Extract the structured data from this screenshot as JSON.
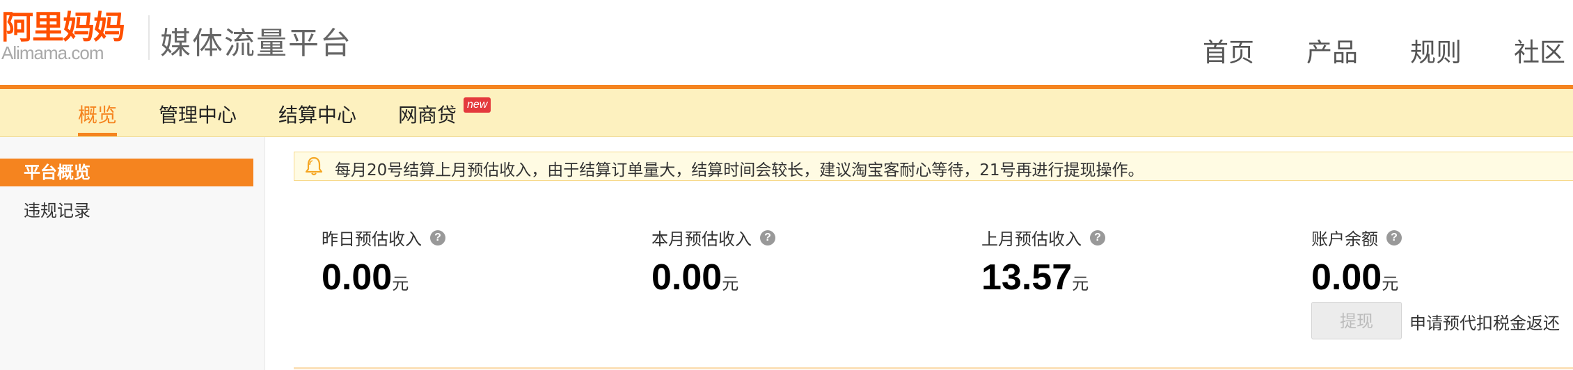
{
  "brand": {
    "logo_cn": "阿里妈妈",
    "logo_en": "Alimama.com",
    "platform_title": "媒体流量平台"
  },
  "top_nav": [
    {
      "label": "首页"
    },
    {
      "label": "产品"
    },
    {
      "label": "规则"
    },
    {
      "label": "社区"
    }
  ],
  "sub_nav": {
    "items": [
      {
        "label": "概览",
        "active": true
      },
      {
        "label": "管理中心"
      },
      {
        "label": "结算中心"
      },
      {
        "label": "网商贷"
      }
    ],
    "new_badge": "new"
  },
  "sidebar": {
    "items": [
      {
        "label": "平台概览",
        "active": true
      },
      {
        "label": "违规记录"
      }
    ]
  },
  "notice": {
    "icon": "bell-icon",
    "text": "每月20号结算上月预估收入，由于结算订单量大，结算时间会较长，建议淘宝客耐心等待，21号再进行提现操作。"
  },
  "stats": [
    {
      "label": "昨日预估收入",
      "value": "0.00",
      "unit": "元"
    },
    {
      "label": "本月预估收入",
      "value": "0.00",
      "unit": "元"
    },
    {
      "label": "上月预估收入",
      "value": "13.57",
      "unit": "元"
    },
    {
      "label": "账户余额",
      "value": "0.00",
      "unit": "元"
    }
  ],
  "help_icon_glyph": "?",
  "account": {
    "withdraw_label": "提现",
    "refund_link": "申请预代扣税金返还"
  },
  "colors": {
    "accent": "#f5841f",
    "subnav_bg": "#fdf1bf",
    "logo": "#ff5000"
  }
}
